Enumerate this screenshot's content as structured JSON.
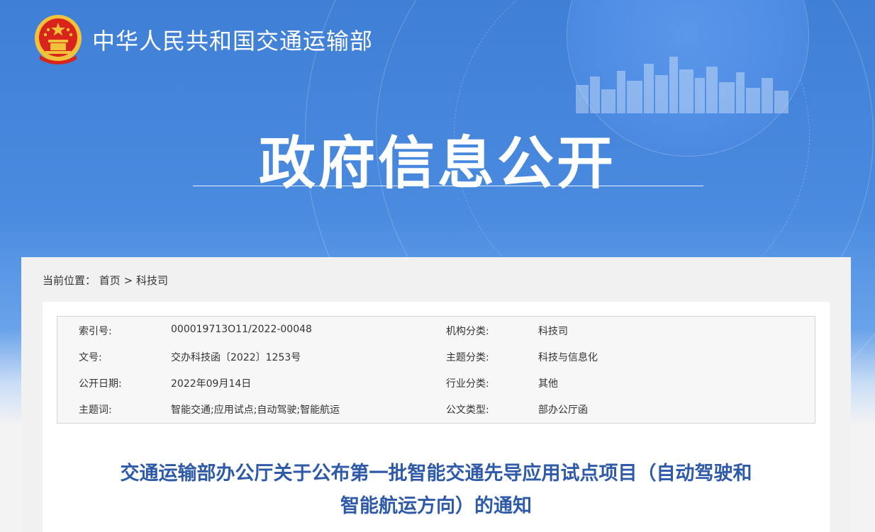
{
  "header": {
    "site_name": "中华人民共和国交通运输部",
    "section_title": "政府信息公开"
  },
  "breadcrumb": {
    "label": "当前位置：",
    "items": [
      "首页",
      "科技司"
    ],
    "separator": ">"
  },
  "metadata": [
    {
      "left_label": "索引号:",
      "left_value": "000019713O11/2022-00048",
      "right_label": "机构分类:",
      "right_value": "科技司"
    },
    {
      "left_label": "文号:",
      "left_value": "交办科技函〔2022〕1253号",
      "right_label": "主题分类:",
      "right_value": "科技与信息化"
    },
    {
      "left_label": "公开日期:",
      "left_value": "2022年09月14日",
      "right_label": "行业分类:",
      "right_value": "其他"
    },
    {
      "left_label": "主题词:",
      "left_value": "智能交通;应用试点;自动驾驶;智能航运",
      "right_label": "公文类型:",
      "right_value": "部办公厅函"
    }
  ],
  "document": {
    "title_line1": "交通运输部办公厅关于公布第一批智能交通先导应用试点项目（自动驾驶和",
    "title_line2": "智能航运方向）的通知"
  },
  "colors": {
    "header_blue": "#4a8be0",
    "title_blue": "#2e5aa8",
    "emblem_red": "#d9241c",
    "emblem_gold": "#f2c23a"
  }
}
